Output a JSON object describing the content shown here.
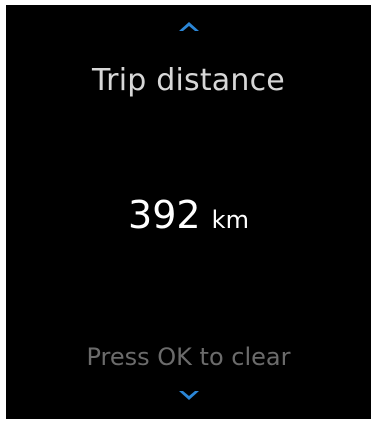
{
  "display": {
    "title": "Trip distance",
    "value": "392",
    "unit": "km",
    "hint": "Press OK to clear"
  },
  "navigation": {
    "up_icon": "chevron-up-icon",
    "down_icon": "chevron-down-icon"
  },
  "colors": {
    "background": "#000000",
    "accent": "#2b86d6",
    "hint_text": "#6b6b6b"
  }
}
